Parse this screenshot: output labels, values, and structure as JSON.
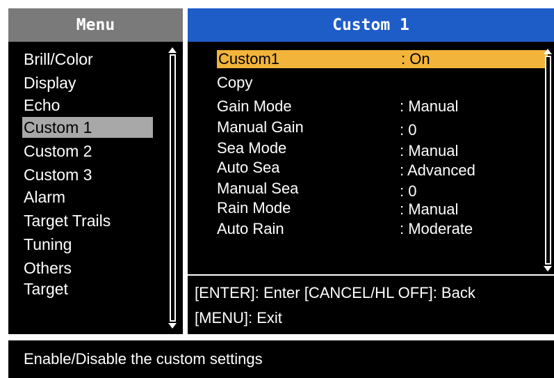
{
  "menu": {
    "title": "Menu",
    "items": [
      {
        "label": "Brill/Color"
      },
      {
        "label": "Display"
      },
      {
        "label": "Echo"
      },
      {
        "label": "Custom 1",
        "selected": true
      },
      {
        "label": "Custom 2"
      },
      {
        "label": "Custom 3"
      },
      {
        "label": "Alarm"
      },
      {
        "label": "Target Trails"
      },
      {
        "label": "Tuning"
      },
      {
        "label": "Others"
      },
      {
        "label": "Target"
      }
    ]
  },
  "detail": {
    "title": "Custom 1",
    "settings": [
      {
        "label": "Custom1",
        "value": ": On",
        "selected": true
      },
      {
        "label": "Copy",
        "value": ""
      },
      {
        "label": "Gain Mode",
        "value": ": Manual"
      },
      {
        "label": "Manual Gain",
        "value": ": 0"
      },
      {
        "label": "Sea Mode",
        "value": ": Manual"
      },
      {
        "label": "Auto Sea",
        "value": ": Advanced"
      },
      {
        "label": "Manual Sea",
        "value": ": 0"
      },
      {
        "label": "Rain Mode",
        "value": ": Manual"
      },
      {
        "label": "Auto Rain",
        "value": ": Moderate"
      }
    ],
    "hint_line1": "[ENTER]: Enter [CANCEL/HL OFF]: Back",
    "hint_line2": "[MENU]: Exit"
  },
  "status": {
    "text": "Enable/Disable the custom settings"
  },
  "colors": {
    "menu_header": "#7a7a7a",
    "detail_header": "#1e5cc8",
    "selection_highlight": "#f2b43a",
    "menu_selection": "#a8a8a8"
  }
}
